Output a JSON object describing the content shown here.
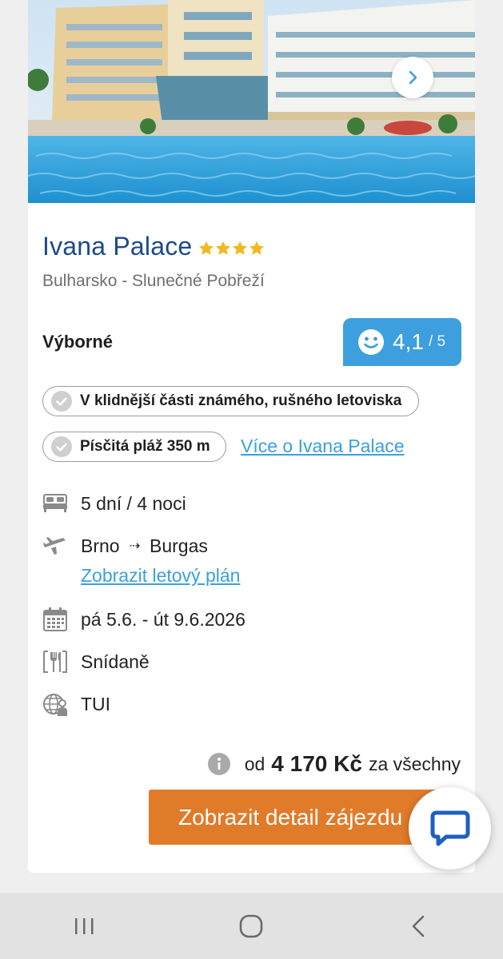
{
  "hotel": {
    "name": "Ivana Palace",
    "stars": 4,
    "location": "Bulharsko - Slunečné Pobřeží",
    "verdict": "Výborné",
    "rating_value": "4,1",
    "rating_max": "/ 5"
  },
  "highlights": [
    "V klidnější části známého, rušného letoviska",
    "Písčitá pláž 350 m"
  ],
  "more_link": "Více o Ivana Palace",
  "details": {
    "duration": "5 dní / 4 noci",
    "from": "Brno",
    "arrow": "⇢",
    "to": "Burgas",
    "flight_plan_link": "Zobrazit letový plán",
    "dates": "pá 5.6. - út 9.6.2026",
    "board": "Snídaně",
    "operator": "TUI"
  },
  "price": {
    "prefix": "od",
    "value": "4 170 Kč",
    "suffix": "za všechny"
  },
  "cta_label": "Zobrazit detail zájezdu",
  "colors": {
    "title": "#1c4a88",
    "accent": "#3d9fdd",
    "link": "#3aa0da",
    "cta": "#e07b2a",
    "star": "#f2b81d"
  },
  "icons": {
    "next": "chevron-right-icon",
    "rating": "smiley-icon",
    "check": "check-circle-icon",
    "duration": "bed-icon",
    "flight": "plane-icon",
    "dates": "calendar-icon",
    "board": "cutlery-icon",
    "operator": "globe-person-icon",
    "info": "info-icon",
    "chat": "chat-bubble-icon"
  }
}
